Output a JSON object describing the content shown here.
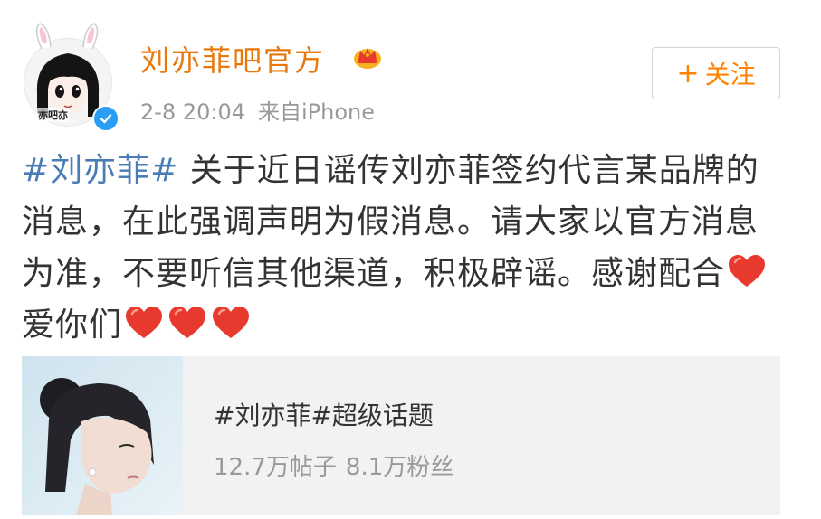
{
  "header": {
    "username": "刘亦菲吧官方",
    "avatar_caption": "亦吧亦",
    "time": "2-8 20:04",
    "source": "来自iPhone",
    "follow": {
      "plus": "+",
      "label": "关注"
    }
  },
  "post": {
    "hashtag": "#刘亦菲#",
    "text_before_hearts": "关于近日谣传刘亦菲签约代言某品牌的消息，在此强调声明为假消息。请大家以官方消息为准，不要听信其他渠道，积极辟谣。感谢配合",
    "text_between": "爱你们",
    "heart_color": "#e8392e"
  },
  "topic_card": {
    "title": "#刘亦菲#超级话题",
    "posts": "12.7万帖子",
    "fans": "8.1万粉丝",
    "background": "#f2f2f2"
  },
  "colors": {
    "username": "#e8780b",
    "link": "#4a7cb5",
    "meta": "#999999",
    "follow": "#ff8200",
    "verified": "#2a9df4"
  }
}
